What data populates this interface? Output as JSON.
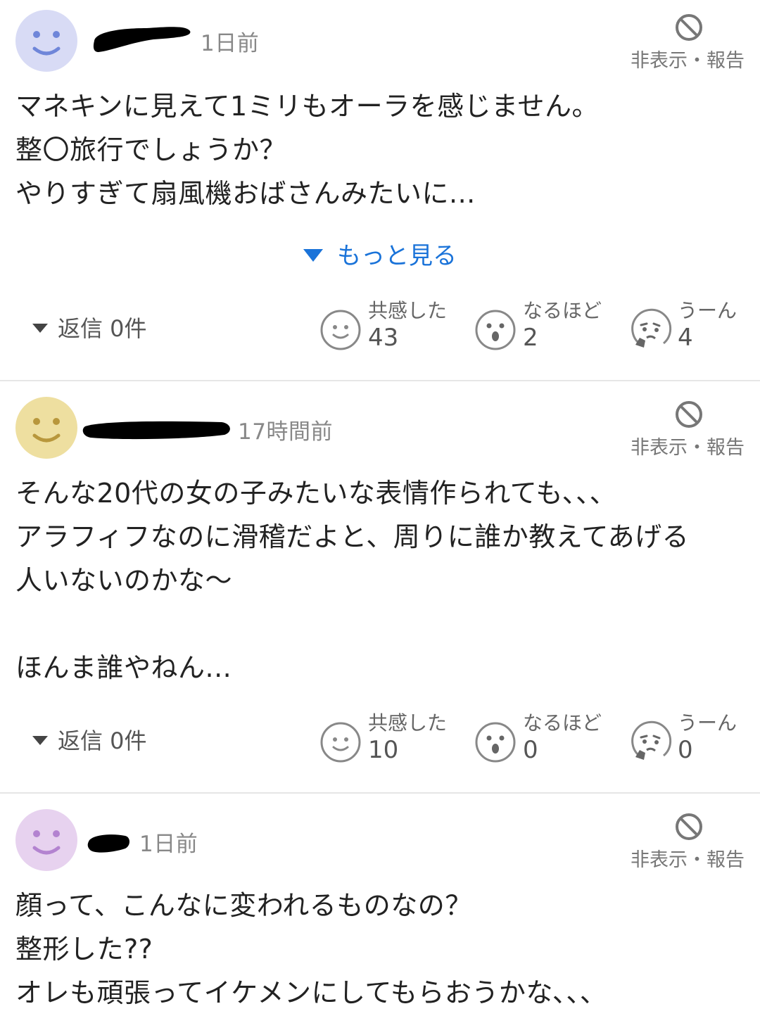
{
  "labels": {
    "hide_report": "非表示・報告",
    "show_more": "もっと見る",
    "reaction_empathy": "共感した",
    "reaction_insight": "なるほど",
    "reaction_hmm": "うーん"
  },
  "colors": {
    "avatar_1": "#d8dbf5",
    "avatar_1_face": "#6f86d9",
    "avatar_2": "#eedfa0",
    "avatar_2_face": "#b8973c",
    "avatar_3": "#e7d2ef",
    "avatar_3_face": "#b383d0",
    "link": "#1a73d9",
    "divider": "#e6e6e6",
    "redaction": "#000000"
  },
  "icons": {
    "hide_report": "ban-icon",
    "empathy": "smile-face-icon",
    "insight": "surprised-face-icon",
    "hmm": "thinking-face-icon",
    "reply_toggle": "triangle-down-icon",
    "show_more": "triangle-down-icon"
  },
  "comments": [
    {
      "time": "1日前",
      "lines": [
        "マネキンに見えて1ミリもオーラを感じません。",
        "整〇旅行でしょうか？",
        "やりすぎて扇風機おばさんみたいに..."
      ],
      "reply": "返信 0件",
      "empathy": "43",
      "insight": "2",
      "hmm": "4"
    },
    {
      "time": "17時間前",
      "lines": [
        "そんな20代の女の子みたいな表情作られても、、、",
        "アラフィフなのに滑稽だよと、周りに誰か教えてあげる",
        "人いないのかな～",
        "",
        "ほんま誰やねん..."
      ],
      "reply": "返信 0件",
      "empathy": "10",
      "insight": "0",
      "hmm": "0"
    },
    {
      "time": "1日前",
      "lines": [
        "顔って、こんなに変われるものなの？",
        "整形した??",
        "オレも頑張ってイケメンにしてもらおうかな､､､"
      ]
    }
  ]
}
